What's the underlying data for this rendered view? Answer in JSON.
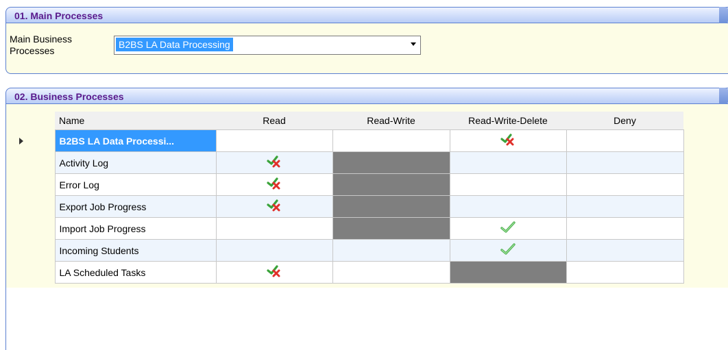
{
  "main_processes": {
    "title": "01. Main Processes",
    "label_line1": "Main Business",
    "label_line2": "Processes",
    "selected_value": "B2BS LA Data Processing"
  },
  "business_processes": {
    "title": "02. Business Processes",
    "columns": [
      "Name",
      "Read",
      "Read-Write",
      "Read-Write-Delete",
      "Deny"
    ],
    "rows": [
      {
        "name": "B2BS LA Data Processi...",
        "read": "",
        "read_write": "",
        "read_write_delete": "partial-icon",
        "deny": "",
        "disabled": ""
      },
      {
        "name": "Activity Log",
        "read": "partial-icon",
        "read_write": "",
        "read_write_delete": "",
        "deny": "",
        "disabled": "read_write"
      },
      {
        "name": "Error Log",
        "read": "partial-icon",
        "read_write": "",
        "read_write_delete": "",
        "deny": "",
        "disabled": "read_write"
      },
      {
        "name": "Export Job Progress",
        "read": "partial-icon",
        "read_write": "",
        "read_write_delete": "",
        "deny": "",
        "disabled": "read_write"
      },
      {
        "name": "Import Job Progress",
        "read": "",
        "read_write": "",
        "read_write_delete": "check-icon",
        "deny": "",
        "disabled": "read_write"
      },
      {
        "name": "Incoming Students",
        "read": "",
        "read_write": "",
        "read_write_delete": "check-icon",
        "deny": "",
        "disabled": ""
      },
      {
        "name": "LA Scheduled Tasks",
        "read": "partial-icon",
        "read_write": "",
        "read_write_delete": "",
        "deny": "",
        "disabled": "read_write_delete"
      }
    ]
  },
  "colors": {
    "panel_title": "#5a1a8c",
    "panel_fill": "#fdfde6",
    "selection": "#3399ff",
    "disabled_cell": "#7f7f7f",
    "alt_row": "#eef5fd"
  }
}
